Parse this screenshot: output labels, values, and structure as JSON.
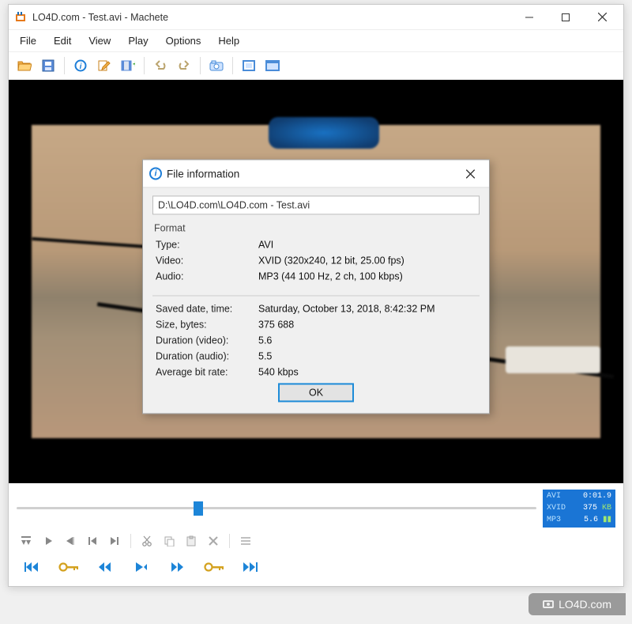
{
  "window": {
    "title": "LO4D.com - Test.avi - Machete"
  },
  "menu": {
    "file": "File",
    "edit": "Edit",
    "view": "View",
    "play": "Play",
    "options": "Options",
    "help": "Help"
  },
  "toolbar_icons": {
    "open": "open-folder-icon",
    "save": "save-icon",
    "info": "info-icon",
    "edit": "pencil-icon",
    "frame": "film-add-icon",
    "undo": "undo-icon",
    "redo": "redo-icon",
    "snapshot": "camera-icon",
    "fit": "fit-window-icon",
    "fullscreen": "fullscreen-icon"
  },
  "dialog": {
    "title": "File information",
    "path": "D:\\LO4D.com\\LO4D.com - Test.avi",
    "format_label": "Format",
    "type_label": "Type:",
    "type_value": "AVI",
    "video_label": "Video:",
    "video_value": "XVID  (320x240, 12 bit, 25.00 fps)",
    "audio_label": "Audio:",
    "audio_value": "MP3  (44 100 Hz, 2 ch, 100 kbps)",
    "saved_label": "Saved date, time:",
    "saved_value": "Saturday, October 13, 2018, 8:42:32 PM",
    "size_label": "Size, bytes:",
    "size_value": "375 688",
    "dur_v_label": "Duration (video):",
    "dur_v_value": "5.6",
    "dur_a_label": "Duration (audio):",
    "dur_a_value": "5.5",
    "abr_label": "Average bit rate:",
    "abr_value": "540 kbps",
    "ok": "OK"
  },
  "info_panel": {
    "container": "AVI",
    "time": "0:01.9",
    "vcodec": "XVID",
    "size": "375",
    "size_unit": "KB",
    "acodec": "MP3",
    "dur": "5.6"
  },
  "watermark": "LO4D.com"
}
